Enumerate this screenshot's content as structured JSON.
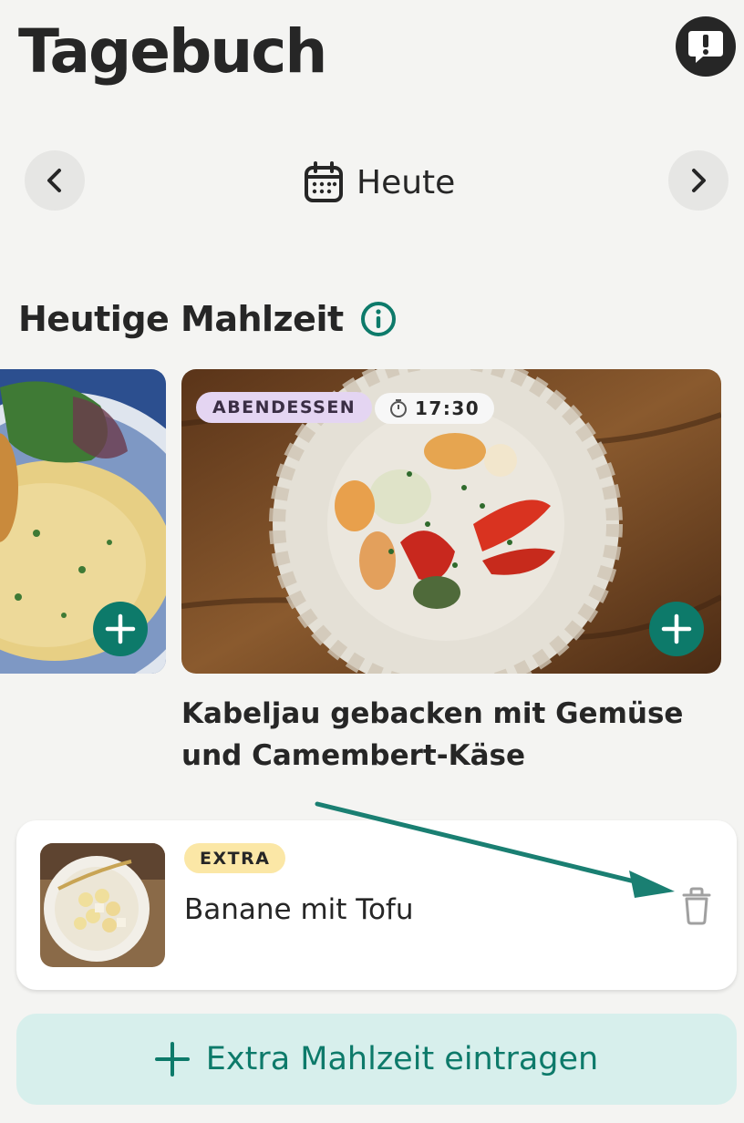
{
  "header": {
    "title": "Tagebuch"
  },
  "date_nav": {
    "label": "Heute"
  },
  "section": {
    "title": "Heutige Mahlzeit"
  },
  "meal": {
    "type_badge": "ABENDESSEN",
    "time": "17:30",
    "name": "Kabeljau gebacken mit Gemüse und Camembert-Käse"
  },
  "extra": {
    "badge": "EXTRA",
    "name": "Banane mit Tofu"
  },
  "add_extra": {
    "label": "Extra Mahlzeit eintragen"
  },
  "colors": {
    "accent": "#0d7a6a",
    "dinner_badge": "#e4d5f2",
    "extra_badge": "#fbe7a6",
    "add_extra_bg": "#d7efec"
  }
}
